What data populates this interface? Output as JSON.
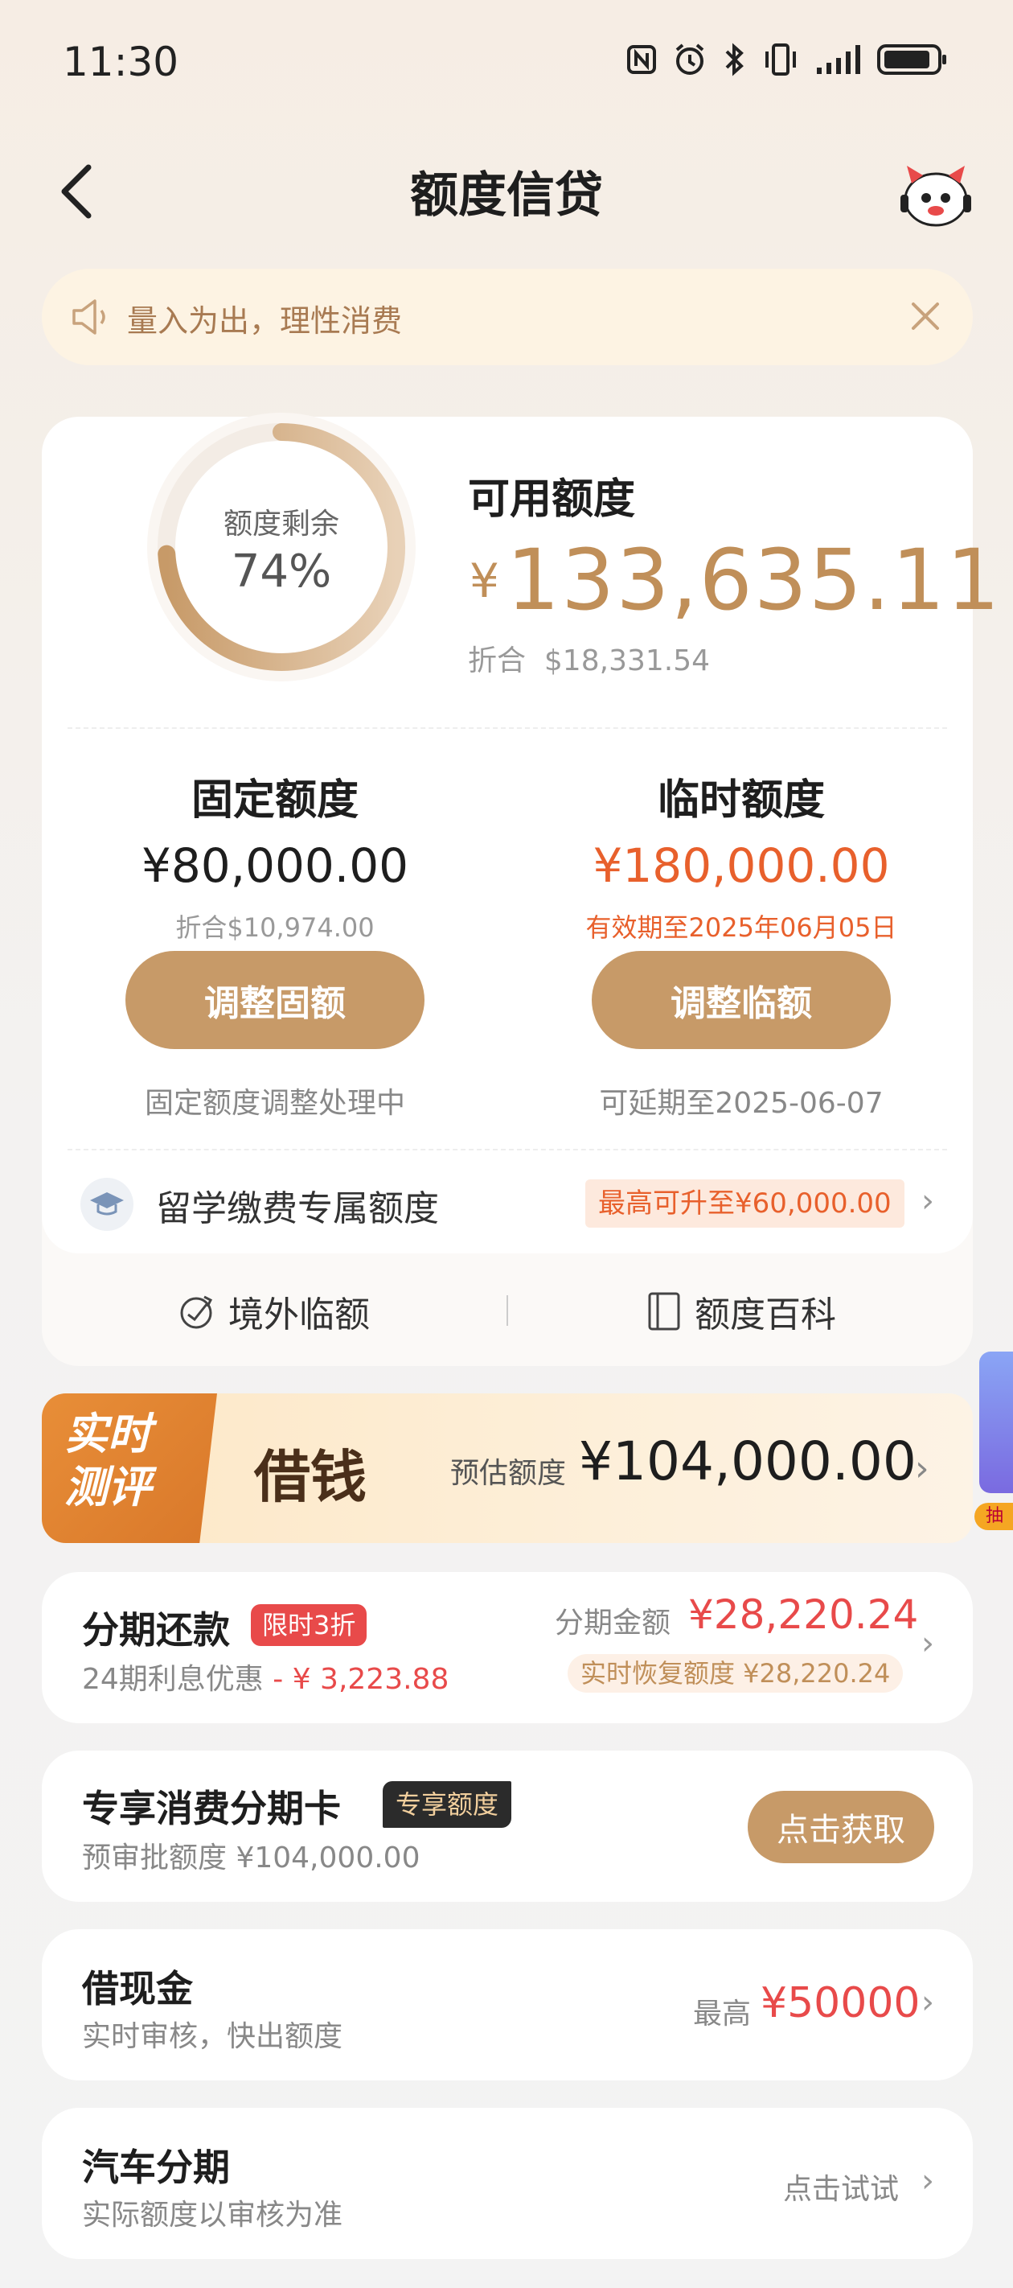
{
  "status_bar": {
    "time": "11:30"
  },
  "nav": {
    "title": "额度信贷"
  },
  "notice": {
    "text": "量入为出，理性消费"
  },
  "quota": {
    "remaining_label": "额度剩余",
    "remaining_percent": "74%",
    "remaining_fraction": 0.74,
    "available_label": "可用额度",
    "currency_symbol": "¥",
    "available_amount": "133,635.11",
    "converted_label": "折合",
    "converted_amount": "$18,331.54"
  },
  "fixed": {
    "title": "固定额度",
    "amount": "¥80,000.00",
    "converted": "折合$10,974.00",
    "button": "调整固额",
    "note": "固定额度调整处理中"
  },
  "temporary": {
    "title": "临时额度",
    "amount": "¥180,000.00",
    "validity": "有效期至2025年06月05日",
    "button": "调整临额",
    "note": "可延期至2025-06-07"
  },
  "study_abroad": {
    "label": "留学缴费专属额度",
    "badge": "最高可升至¥60,000.00"
  },
  "links": {
    "overseas": "境外临额",
    "wiki": "额度百科"
  },
  "banner": {
    "tag_line1": "实时",
    "tag_line2": "测评",
    "title": "借钱",
    "estimate_label": "预估额度",
    "estimate_amount": "¥104,000.00"
  },
  "installment": {
    "title": "分期还款",
    "badge": "限时3折",
    "sub_prefix": "24期利息优惠",
    "sub_discount": "- ¥ 3,223.88",
    "amount_label": "分期金额",
    "amount": "¥28,220.24",
    "restore": "实时恢复额度 ¥28,220.24"
  },
  "exclusive_card": {
    "title": "专享消费分期卡",
    "badge": "专享额度",
    "sub": "预审批额度 ¥104,000.00",
    "button": "点击获取"
  },
  "cash": {
    "title": "借现金",
    "sub": "实时审核，快出额度",
    "max_label": "最高",
    "max_amount": "¥50000"
  },
  "car": {
    "title": "汽车分期",
    "sub": "实际额度以审核为准",
    "action": "点击试试"
  },
  "side": {
    "tab_text": "抽"
  },
  "colors": {
    "gold": "#c79a68",
    "red": "#e84a4a",
    "orange": "#e8602c"
  }
}
